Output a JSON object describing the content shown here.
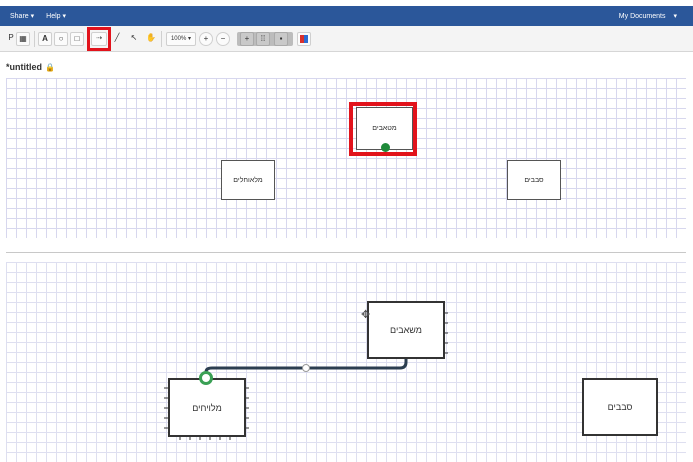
{
  "topbar": {
    "menu_share": "Share",
    "menu_help": "Help",
    "my_documents": "My Documents"
  },
  "toolbar": {
    "text_tool": "A",
    "zoom_level": "100%"
  },
  "document": {
    "title": "*untitled"
  },
  "diagram_top": {
    "node_center": "מטאבים",
    "node_left": "מלאוחלים",
    "node_right": "סבבים"
  },
  "diagram_bottom": {
    "node_center": "משאבים",
    "node_left": "מלויחים",
    "node_right": "סבבים"
  },
  "colors": {
    "nav_bar": "#2b579a",
    "highlight": "#e2131c",
    "connector": "#2c3e50",
    "anchor_green": "#3aa055"
  }
}
